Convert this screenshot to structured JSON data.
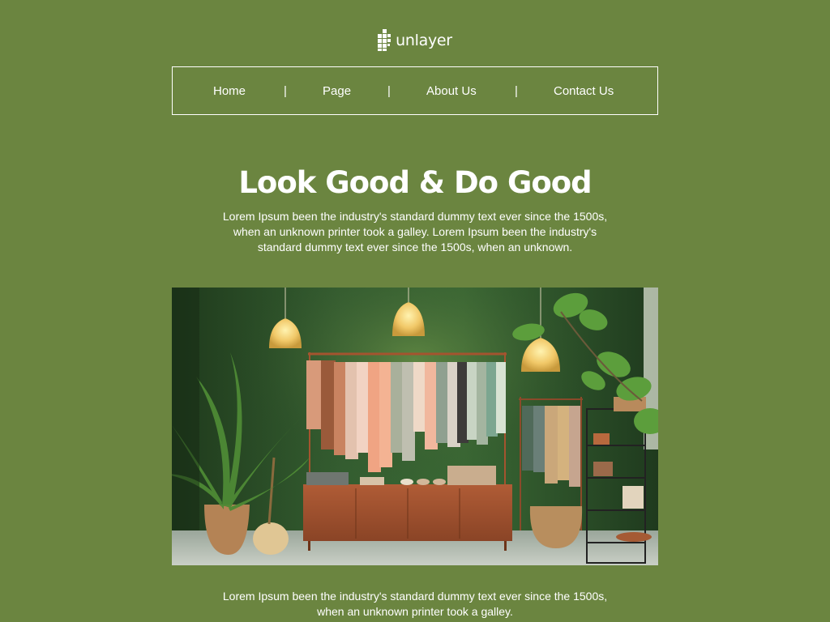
{
  "brand": {
    "logo_text": "unlayer",
    "logo_icon": "pixel-grid-icon"
  },
  "nav": {
    "items": [
      {
        "label": "Home"
      },
      {
        "label": "Page"
      },
      {
        "label": "About Us"
      },
      {
        "label": "Contact Us"
      }
    ],
    "separator": "|"
  },
  "hero": {
    "title": "Look Good & Do Good",
    "text": "Lorem Ipsum been the industry's standard dummy text ever since the 1500s, when an unknown printer took a galley. Lorem Ipsum been the industry's standard dummy text ever since the 1500s, when an unknown."
  },
  "image": {
    "subject": "clothing-store-interior-photo"
  },
  "footer_text": "Lorem Ipsum been the industry's standard dummy text ever since the 1500s, when an unknown printer took a galley.",
  "colors": {
    "background": "#6b8540",
    "text": "#ffffff"
  }
}
